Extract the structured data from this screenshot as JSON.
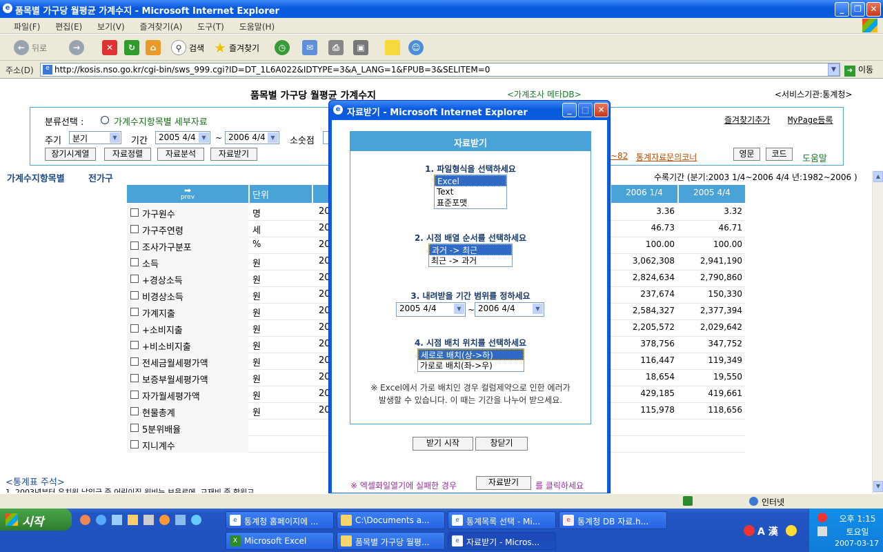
{
  "window": {
    "title": "품목별 가구당 월평균 가계수지 - Microsoft Internet Explorer"
  },
  "menu": [
    "파일(F)",
    "편집(E)",
    "보기(V)",
    "즐겨찾기(A)",
    "도구(T)",
    "도움말(H)"
  ],
  "toolbar": {
    "back": "뒤로",
    "search": "검색",
    "favorites": "즐겨찾기"
  },
  "address": {
    "label": "주소(D)",
    "url": "http://kosis.nso.go.kr/cgi-bin/sws_999.cgi?ID=DT_1L6A022&IDTYPE=3&A_LANG=1&FPUB=3&SELITEM=0",
    "go": "이동"
  },
  "page": {
    "title": "품목별 가구당 월평균 가계수지",
    "meta_link": "<가계조사 메타DB>",
    "agency": "<서비스기관:통계청>",
    "favorite_add": "즐겨찾기추가",
    "mypage": "MyPage등록",
    "classify_label": "분류선택 :",
    "classify_option": "가계수지항목별 세부자료",
    "period_label": "주기",
    "period_value": "분기",
    "range_label": "기간",
    "range_from": "2005 4/4",
    "range_tilde": "~",
    "range_to": "2006 4/4",
    "decimal_label": "소숫점",
    "buttons": [
      "장기시계열",
      "자료정렬",
      "자료분석",
      "자료받기"
    ],
    "right_buttons": [
      "영문",
      "코드"
    ],
    "help": "도움말",
    "inquiry_prefix": "~82",
    "inquiry": "통계자료문의코너",
    "breadcrumb1": "가계수지항목별",
    "breadcrumb2": "전가구",
    "collection": "수록기간 (분기:2003 1/4~2006 4/4  년:1982~2006 )",
    "notes": "<통계표 주석>",
    "notes_line": "1. 2003년부터 유치원 납입금 중 어린이집 원비는 보육료에, 교재비 중 학원교"
  },
  "table": {
    "prev": "prev",
    "unit_header": "단위",
    "col_headers": [
      "2006 1/4",
      "2005 4/4"
    ],
    "rows": [
      {
        "name": "가구원수",
        "unit": "명",
        "y": "20",
        "a": "3.36",
        "b": "3.32"
      },
      {
        "name": "가구주연령",
        "unit": "세",
        "y": "20",
        "a": "46.73",
        "b": "46.71"
      },
      {
        "name": "조사가구분포",
        "unit": "%",
        "y": "20",
        "a": "100.00",
        "b": "100.00"
      },
      {
        "name": "소득",
        "unit": "원",
        "y": "20",
        "a": "3,062,308",
        "b": "2,941,190"
      },
      {
        "name": "+경상소득",
        "unit": "원",
        "y": "20",
        "a": "2,824,634",
        "b": "2,790,860"
      },
      {
        "name": "비경상소득",
        "unit": "원",
        "y": "20",
        "a": "237,674",
        "b": "150,330"
      },
      {
        "name": "가계지출",
        "unit": "원",
        "y": "20",
        "a": "2,584,327",
        "b": "2,377,394"
      },
      {
        "name": "+소비지출",
        "unit": "원",
        "y": "20",
        "a": "2,205,572",
        "b": "2,029,642"
      },
      {
        "name": "+비소비지출",
        "unit": "원",
        "y": "20",
        "a": "378,756",
        "b": "347,752"
      },
      {
        "name": "전세금월세평가액",
        "unit": "원",
        "y": "20",
        "a": "116,447",
        "b": "119,349"
      },
      {
        "name": "보증부월세평가액",
        "unit": "원",
        "y": "20",
        "a": "18,654",
        "b": "19,550"
      },
      {
        "name": "자가월세평가액",
        "unit": "원",
        "y": "20",
        "a": "429,185",
        "b": "419,661"
      },
      {
        "name": "현물총계",
        "unit": "원",
        "y": "20",
        "a": "115,978",
        "b": "118,656"
      },
      {
        "name": "5분위배율",
        "unit": "",
        "y": "",
        "a": "",
        "b": ""
      },
      {
        "name": "지니계수",
        "unit": "",
        "y": "",
        "a": "",
        "b": ""
      }
    ]
  },
  "dialog": {
    "title": "자료받기 - Microsoft Internet Explorer",
    "header": "자료받기",
    "q1": "1. 파일형식을 선택하세요",
    "q1_options": [
      "Excel",
      "Text",
      "표준포맷"
    ],
    "q2": "2. 시점 배열 순서를 선택하세요",
    "q2_options": [
      "과거 -> 최근",
      "최근 -> 과거"
    ],
    "q3": "3. 내려받을 기간 범위를 정하세요",
    "q3_from": "2005 4/4",
    "q3_tilde": "~",
    "q3_to": "2006 4/4",
    "q4": "4. 시점 배치 위치를 선택하세요",
    "q4_options": [
      "세로로 배치(상->하)",
      "가로로 배치(좌->우)"
    ],
    "note_line1": "※ Excel에서 가로 배치인 경우 컬럼제약으로 인한 에러가",
    "note_line2": "발생할 수 있습니다. 이 때는 기간을 나누어 받으세요.",
    "start": "받기 시작",
    "close": "창닫기",
    "footer_prefix": "※ 엑셀화일열기에 실패한 경우",
    "footer_btn": "자료받기",
    "footer_suffix": "를 클릭하세요"
  },
  "status": {
    "zone": "인터넷"
  },
  "taskbar": {
    "start": "시작",
    "tasks": [
      "통계청 홈페이지에 ...",
      "C:\\Documents a...",
      "통계목록 선택 - Mi...",
      "통계청 DB 자료.h...",
      "Microsoft Excel",
      "품목별 가구당 월평...",
      "자료받기 - Micros..."
    ],
    "ime": "A 漢",
    "time": "오후 1:15",
    "day": "토요일",
    "date": "2007-03-17"
  }
}
